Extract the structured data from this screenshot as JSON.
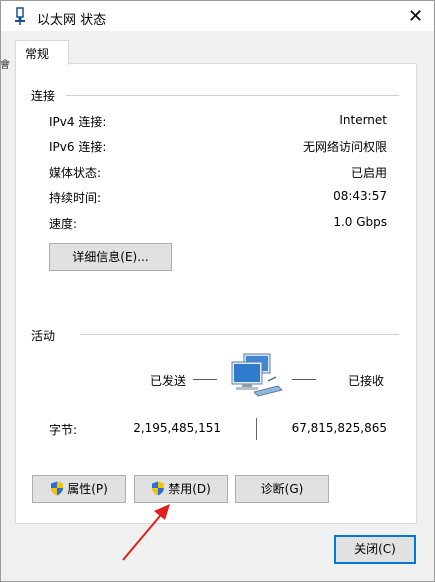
{
  "window": {
    "title": "以太网 状态",
    "close_glyph": "✕",
    "edge_fragment": "會"
  },
  "tabs": [
    {
      "label": "常规"
    }
  ],
  "connection": {
    "header": "连接",
    "rows": [
      {
        "label": "IPv4 连接:",
        "value": "Internet"
      },
      {
        "label": "IPv6 连接:",
        "value": "无网络访问权限"
      },
      {
        "label": "媒体状态:",
        "value": "已启用"
      },
      {
        "label": "持续时间:",
        "value": "08:43:57"
      },
      {
        "label": "速度:",
        "value": "1.0 Gbps"
      }
    ],
    "details_button": "详细信息(E)..."
  },
  "activity": {
    "header": "活动",
    "sent_label": "已发送",
    "received_label": "已接收",
    "bytes_label": "字节:",
    "bytes_sent": "2,195,485,151",
    "bytes_received": "67,815,825,865"
  },
  "buttons": {
    "properties": "属性(P)",
    "disable": "禁用(D)",
    "diagnose": "诊断(G)",
    "close": "关闭(C)"
  },
  "icons": {
    "window": "network-icon",
    "activity": "network-computers-icon",
    "shield": "uac-shield-icon",
    "annotation": "red-arrow"
  },
  "colors": {
    "annotation_arrow": "#e02020",
    "focus_border": "#0078d7",
    "shield_blue": "#2a6fd1",
    "shield_yellow": "#f5c400"
  }
}
